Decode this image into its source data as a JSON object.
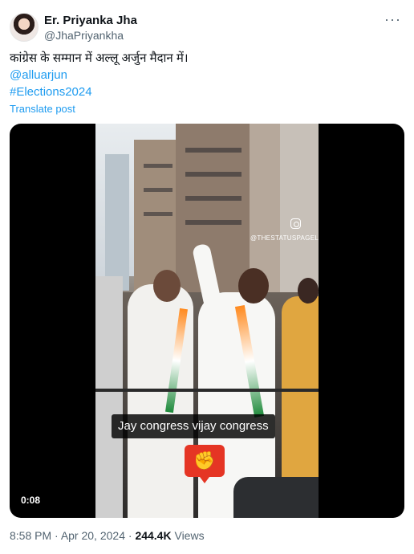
{
  "author": {
    "display_name": "Er. Priyanka Jha",
    "handle": "@JhaPriyankha"
  },
  "more_icon": "more-horizontal-icon",
  "post": {
    "text": "कांग्रेस के सम्मान में अल्लू अर्जुन मैदान में।",
    "mention": "@alluarjun",
    "hashtag": "#Elections2024",
    "translate_label": "Translate post"
  },
  "video": {
    "watermark": "@THESTATUSPAGEL",
    "caption": "Jay congress vijay congress",
    "duration": "0:08",
    "sticker_icon": "raised-fist-icon"
  },
  "footer": {
    "time": "8:58 PM",
    "separator1": " · ",
    "date": "Apr 20, 2024",
    "separator2": " · ",
    "views_count": "244.4K",
    "views_label": " Views"
  },
  "colors": {
    "link": "#1d9bf0",
    "secondary_text": "#536471",
    "primary_text": "#0f1419",
    "sticker": "#e53524"
  }
}
